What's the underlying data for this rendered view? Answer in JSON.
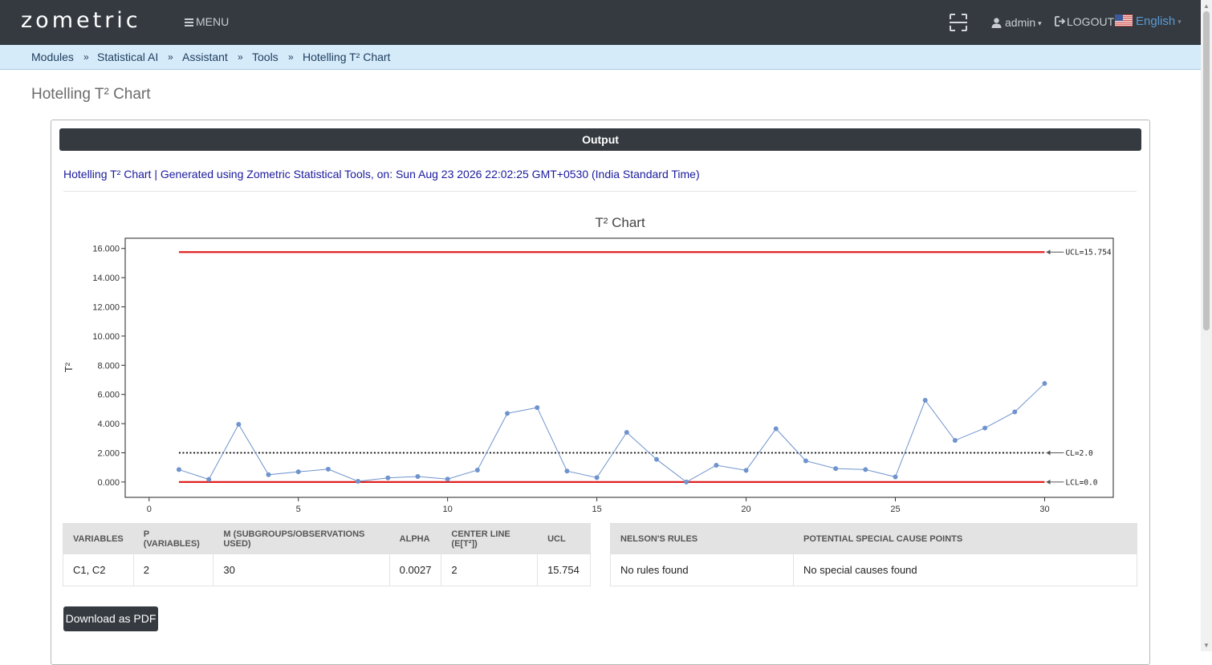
{
  "navbar": {
    "logo": "zometric",
    "menu_label": "MENU",
    "user_label": "admin",
    "logout_label": "LOGOUT",
    "language_label": "English"
  },
  "breadcrumb": [
    "Modules",
    "Statistical AI",
    "Assistant",
    "Tools",
    "Hotelling T² Chart"
  ],
  "breadcrumb_separator": "»",
  "page_title": "Hotelling T² Chart",
  "output": {
    "header": "Output",
    "generated_line": "Hotelling T² Chart | Generated using Zometric Statistical Tools, on: Sun Aug 23 2026 22:02:25 GMT+0530 (India Standard Time)"
  },
  "chart_data": {
    "type": "line",
    "title": "T² Chart",
    "xlabel": "",
    "ylabel": "T²",
    "xlim": [
      -0.8,
      32.3
    ],
    "ylim": [
      -1.05,
      16.7
    ],
    "x_ticks": [
      0,
      5,
      10,
      15,
      20,
      25,
      30
    ],
    "y_ticks": [
      0,
      2,
      4,
      6,
      8,
      10,
      12,
      14,
      16
    ],
    "y_tick_labels": [
      "0.000",
      "2.000",
      "4.000",
      "6.000",
      "8.000",
      "10.000",
      "12.000",
      "14.000",
      "16.000"
    ],
    "series": [
      {
        "x": [
          1,
          2,
          3,
          4,
          5,
          6,
          7,
          8,
          9,
          10,
          11,
          12,
          13,
          14,
          15,
          16,
          17,
          18,
          19,
          20,
          21,
          22,
          23,
          24,
          25,
          26,
          27,
          28,
          29,
          30
        ],
        "values": [
          0.85,
          0.18,
          3.95,
          0.5,
          0.7,
          0.88,
          0.05,
          0.28,
          0.38,
          0.2,
          0.82,
          4.7,
          5.1,
          0.75,
          0.3,
          3.4,
          1.55,
          0.0,
          1.15,
          0.8,
          3.65,
          1.45,
          0.92,
          0.85,
          0.35,
          5.6,
          2.85,
          3.7,
          4.8,
          6.75
        ],
        "color": "#6f94cd"
      }
    ],
    "control_lines": [
      {
        "label": "UCL=15.754",
        "value": 15.754,
        "color": "#e02020",
        "style": "solid"
      },
      {
        "label": "CL=2.0",
        "value": 2.0,
        "color": "#000000",
        "style": "dotted"
      },
      {
        "label": "LCL=0.0",
        "value": 0.0,
        "color": "#e02020",
        "style": "solid"
      }
    ]
  },
  "summary_table": {
    "headers": [
      "VARIABLES",
      "P (VARIABLES)",
      "M (SUBGROUPS/OBSERVATIONS USED)",
      "ALPHA",
      "CENTER LINE (E[T²])",
      "UCL"
    ],
    "row": [
      "C1, C2",
      "2",
      "30",
      "0.0027",
      "2",
      "15.754"
    ]
  },
  "rules_table": {
    "headers": [
      "NELSON'S RULES",
      "POTENTIAL SPECIAL CAUSE POINTS"
    ],
    "row": [
      "No rules found",
      "No special causes found"
    ]
  },
  "download_label": "Download as PDF"
}
